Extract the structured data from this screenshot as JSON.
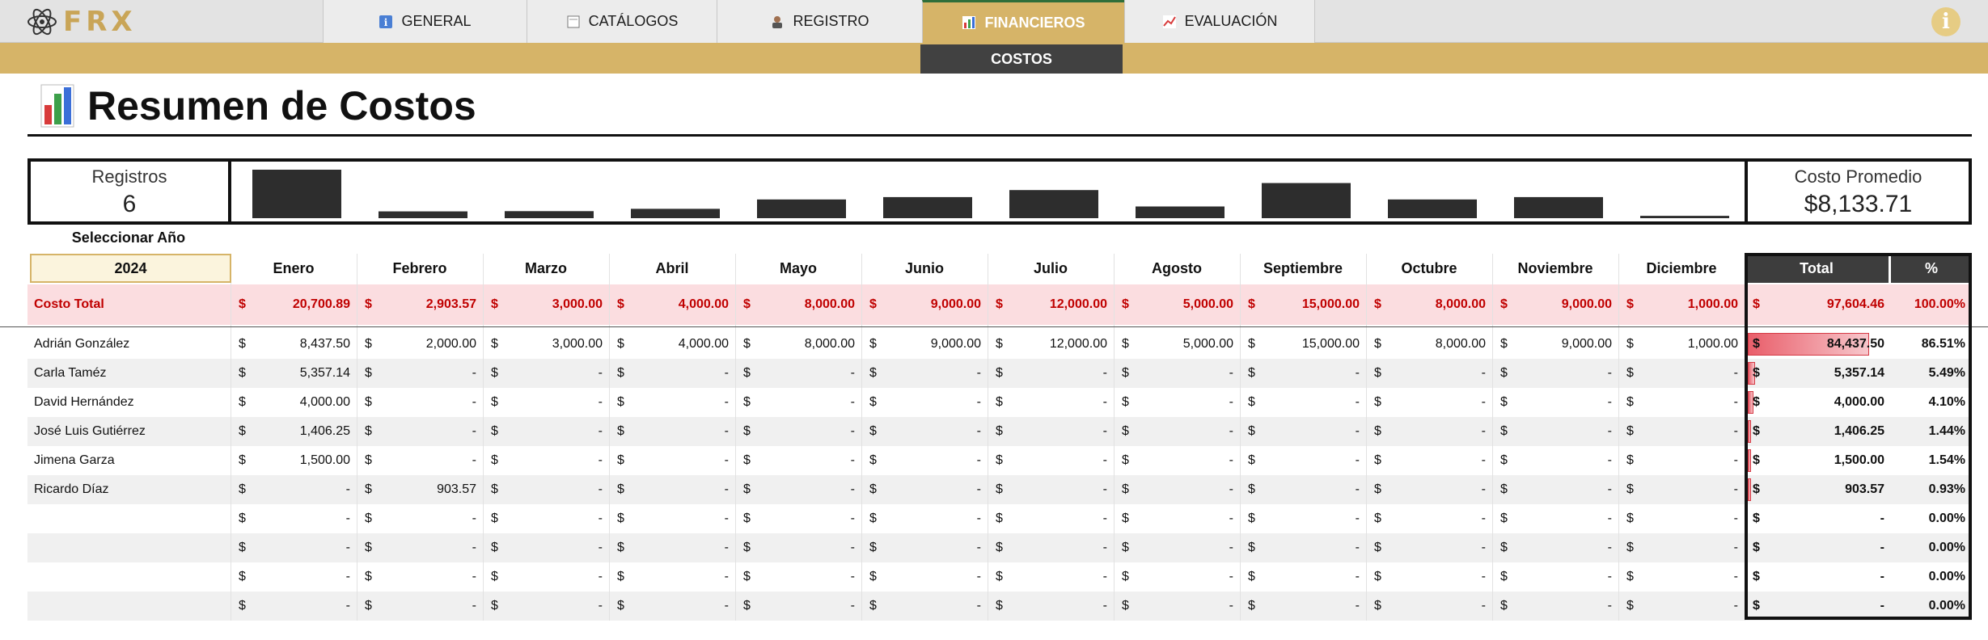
{
  "app": {
    "logo_text": "FRX"
  },
  "nav": {
    "tabs": [
      {
        "label": "GENERAL",
        "icon": "info-icon"
      },
      {
        "label": "CATÁLOGOS",
        "icon": "catalog-icon"
      },
      {
        "label": "REGISTRO",
        "icon": "user-icon"
      },
      {
        "label": "FINANCIEROS",
        "icon": "bar-chart-icon",
        "active": true
      },
      {
        "label": "EVALUACIÓN",
        "icon": "trend-icon"
      }
    ],
    "subtab": "COSTOS",
    "info_button": "i"
  },
  "page": {
    "title": "Resumen de Costos"
  },
  "stats": {
    "records_label": "Registros",
    "records_value": "6",
    "avg_label": "Costo Promedio",
    "avg_value": "$8,133.71"
  },
  "year": {
    "label": "Seleccionar Año",
    "value": "2024"
  },
  "table": {
    "currency": "$",
    "months": [
      "Enero",
      "Febrero",
      "Marzo",
      "Abril",
      "Mayo",
      "Junio",
      "Julio",
      "Agosto",
      "Septiembre",
      "Octubre",
      "Noviembre",
      "Diciembre"
    ],
    "total_header": "Total",
    "pct_header": "%",
    "total_row": {
      "label": "Costo Total",
      "values": [
        "20,700.89",
        "2,903.57",
        "3,000.00",
        "4,000.00",
        "8,000.00",
        "9,000.00",
        "12,000.00",
        "5,000.00",
        "15,000.00",
        "8,000.00",
        "9,000.00",
        "1,000.00"
      ],
      "total": "97,604.46",
      "pct": "100.00%"
    },
    "rows": [
      {
        "name": "Adrián González",
        "values": [
          "8,437.50",
          "2,000.00",
          "3,000.00",
          "4,000.00",
          "8,000.00",
          "9,000.00",
          "12,000.00",
          "5,000.00",
          "15,000.00",
          "8,000.00",
          "9,000.00",
          "1,000.00"
        ],
        "total": "84,437.50",
        "pct": "86.51%",
        "share": 0.8651
      },
      {
        "name": "Carla Taméz",
        "values": [
          "5,357.14",
          "-",
          "-",
          "-",
          "-",
          "-",
          "-",
          "-",
          "-",
          "-",
          "-",
          "-"
        ],
        "total": "5,357.14",
        "pct": "5.49%",
        "share": 0.0549
      },
      {
        "name": "David Hernández",
        "values": [
          "4,000.00",
          "-",
          "-",
          "-",
          "-",
          "-",
          "-",
          "-",
          "-",
          "-",
          "-",
          "-"
        ],
        "total": "4,000.00",
        "pct": "4.10%",
        "share": 0.041
      },
      {
        "name": "José Luis Gutiérrez",
        "values": [
          "1,406.25",
          "-",
          "-",
          "-",
          "-",
          "-",
          "-",
          "-",
          "-",
          "-",
          "-",
          "-"
        ],
        "total": "1,406.25",
        "pct": "1.44%",
        "share": 0.0144
      },
      {
        "name": "Jimena Garza",
        "values": [
          "1,500.00",
          "-",
          "-",
          "-",
          "-",
          "-",
          "-",
          "-",
          "-",
          "-",
          "-",
          "-"
        ],
        "total": "1,500.00",
        "pct": "1.54%",
        "share": 0.0154
      },
      {
        "name": "Ricardo Díaz",
        "values": [
          "-",
          "903.57",
          "-",
          "-",
          "-",
          "-",
          "-",
          "-",
          "-",
          "-",
          "-",
          "-"
        ],
        "total": "903.57",
        "pct": "0.93%",
        "share": 0.0093
      },
      {
        "name": "",
        "values": [
          "-",
          "-",
          "-",
          "-",
          "-",
          "-",
          "-",
          "-",
          "-",
          "-",
          "-",
          "-"
        ],
        "total": "-",
        "pct": "0.00%",
        "share": 0
      },
      {
        "name": "",
        "values": [
          "-",
          "-",
          "-",
          "-",
          "-",
          "-",
          "-",
          "-",
          "-",
          "-",
          "-",
          "-"
        ],
        "total": "-",
        "pct": "0.00%",
        "share": 0
      },
      {
        "name": "",
        "values": [
          "-",
          "-",
          "-",
          "-",
          "-",
          "-",
          "-",
          "-",
          "-",
          "-",
          "-",
          "-"
        ],
        "total": "-",
        "pct": "0.00%",
        "share": 0
      },
      {
        "name": "",
        "values": [
          "-",
          "-",
          "-",
          "-",
          "-",
          "-",
          "-",
          "-",
          "-",
          "-",
          "-",
          "-"
        ],
        "total": "-",
        "pct": "0.00%",
        "share": 0
      }
    ]
  },
  "chart_data": {
    "type": "bar",
    "categories": [
      "Enero",
      "Febrero",
      "Marzo",
      "Abril",
      "Mayo",
      "Junio",
      "Julio",
      "Agosto",
      "Septiembre",
      "Octubre",
      "Noviembre",
      "Diciembre"
    ],
    "values": [
      20700.89,
      2903.57,
      3000,
      4000,
      8000,
      9000,
      12000,
      5000,
      15000,
      8000,
      9000,
      1000
    ],
    "color": "#2d2d2d",
    "axes": "hidden"
  },
  "colors": {
    "accent_gold": "#d6b468",
    "total_text": "#c00000",
    "total_bg": "#fbdde0",
    "header_dark": "#3d3d3d",
    "databar": "#e95e6a"
  }
}
